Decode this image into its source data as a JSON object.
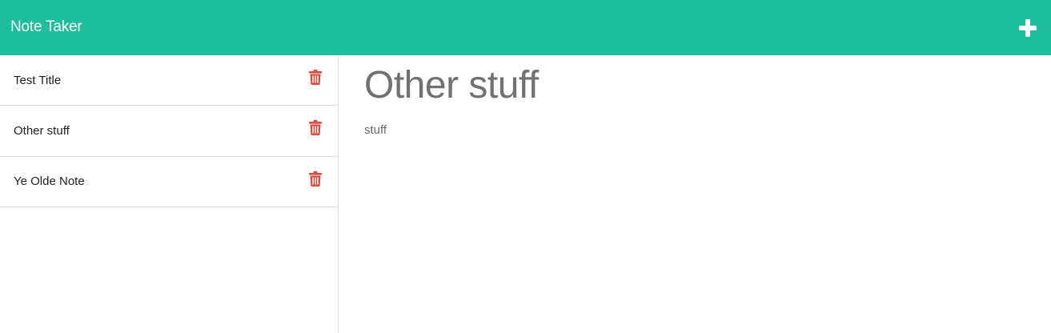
{
  "app": {
    "title": "Note Taker",
    "accent_color": "#1dbe9b",
    "delete_color": "#dc4b3c"
  },
  "toolbar": {
    "add_icon": "plus-icon"
  },
  "notes": [
    {
      "title": "Test Title",
      "delete_icon": "trash-icon"
    },
    {
      "title": "Other stuff",
      "delete_icon": "trash-icon"
    },
    {
      "title": "Ye Olde Note",
      "delete_icon": "trash-icon"
    }
  ],
  "active_note": {
    "title": "Other stuff",
    "body": "stuff"
  }
}
